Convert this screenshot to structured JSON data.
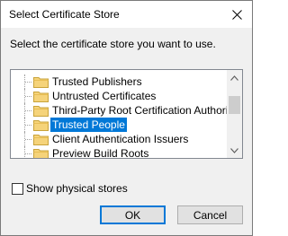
{
  "dialog": {
    "title": "Select Certificate Store",
    "prompt": "Select the certificate store you want to use."
  },
  "stores": [
    {
      "label": "Trusted Publishers",
      "selected": false
    },
    {
      "label": "Untrusted Certificates",
      "selected": false
    },
    {
      "label": "Third-Party Root Certification Authorities",
      "selected": false
    },
    {
      "label": "Trusted People",
      "selected": true
    },
    {
      "label": "Client Authentication Issuers",
      "selected": false
    },
    {
      "label": "Preview Build Roots",
      "selected": false
    }
  ],
  "options": {
    "show_physical_label": "Show physical stores",
    "show_physical_checked": false
  },
  "buttons": {
    "ok_label": "OK",
    "cancel_label": "Cancel"
  },
  "icons": {
    "close": "close-icon",
    "folder": "folder-icon",
    "scroll_up": "scroll-up-arrow-icon",
    "scroll_down": "scroll-down-arrow-icon"
  },
  "colors": {
    "selection": "#0078d7",
    "folder": "#f5d37a"
  }
}
